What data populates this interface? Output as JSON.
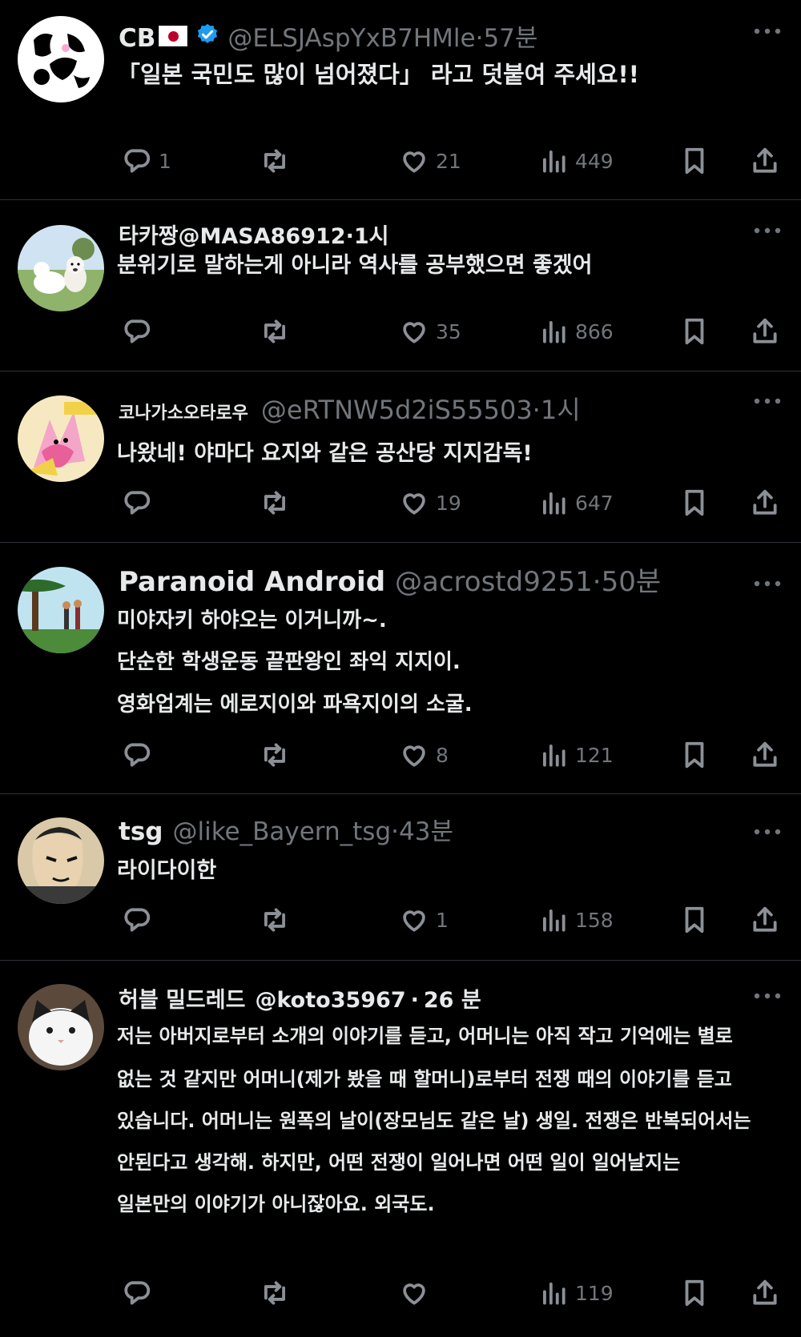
{
  "posts": [
    {
      "name": "CB",
      "handle": "@ELSJAspYxB7HMle",
      "dot": "·",
      "time": "57분",
      "lines": [
        "「일본 국민도 많이 넘어졌다」 라고 덧붙여 주세요!!"
      ],
      "reply_count": "1",
      "retweet_count": "",
      "like_count": "21",
      "view_count": "449"
    },
    {
      "name": "타카짱",
      "handle": "@MASA86912",
      "dot": "·",
      "time": "1시",
      "lines": [
        "분위기로 말하는게 아니라 역사를 공부했으면 좋겠어"
      ],
      "reply_count": "",
      "retweet_count": "",
      "like_count": "35",
      "view_count": "866"
    },
    {
      "name": "코나가소오타로우",
      "handle": "@eRTNW5d2iS55503",
      "dot": "·",
      "time": "1시",
      "lines": [
        "나왔네! 야마다 요지와 같은 공산당 지지감독!"
      ],
      "reply_count": "",
      "retweet_count": "",
      "like_count": "19",
      "view_count": "647"
    },
    {
      "name": "Paranoid Android",
      "handle": "@acrostd9251",
      "dot": "·",
      "time": "50분",
      "lines": [
        "미야자키 하야오는 이거니까~.",
        "단순한 학생운동 끝판왕인 좌익 지지이.",
        "영화업계는 에로지이와 파욕지이의 소굴."
      ],
      "reply_count": "",
      "retweet_count": "",
      "like_count": "8",
      "view_count": "121"
    },
    {
      "name": "tsg",
      "handle": "@like_Bayern_tsg",
      "dot": "·",
      "time": "43분",
      "lines": [
        "라이다이한"
      ],
      "reply_count": "",
      "retweet_count": "",
      "like_count": "1",
      "view_count": "158"
    },
    {
      "name": "허블 밀드레드",
      "handle": "@koto35967",
      "dot": "·",
      "time": "26 분",
      "lines": [
        "저는 아버지로부터 소개의 이야기를 듣고, 어머니는 아직 작고 기억에는 별로",
        "없는 것 같지만 어머니(제가 봤을 때 할머니)로부터 전쟁 때의 이야기를 듣고",
        "있습니다. 어머니는 원폭의 날이(장모님도 같은 날) 생일. 전쟁은 반복되어서는",
        "안된다고 생각해. 하지만, 어떤 전쟁이 일어나면 어떤 일이 일어날지는",
        "일본만의 이야기가 아니잖아요. 외국도."
      ],
      "reply_count": "",
      "retweet_count": "",
      "like_count": "",
      "view_count": "119"
    }
  ],
  "colors": {
    "background": "#000000",
    "text": "#e7e9ea",
    "muted": "#71767b",
    "divider": "#2f3336",
    "verified": "#1d9bf0"
  },
  "icons": [
    "reply-icon",
    "retweet-icon",
    "like-icon",
    "views-icon",
    "bookmark-icon",
    "share-icon",
    "more-icon",
    "verified-badge-icon",
    "japan-flag-icon"
  ]
}
